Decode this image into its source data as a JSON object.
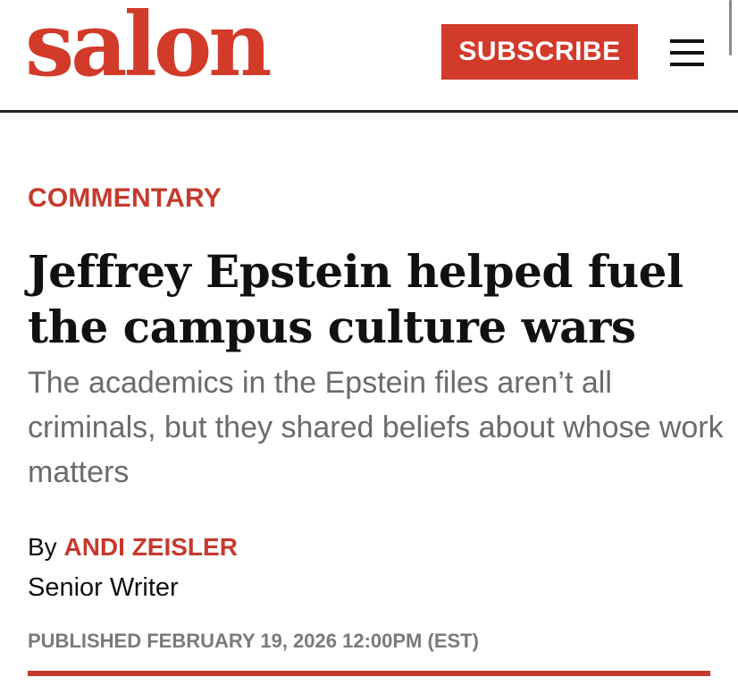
{
  "header": {
    "logo_text": "salon",
    "subscribe_label": "SUBSCRIBE",
    "menu_icon": "hamburger-menu-icon"
  },
  "article": {
    "kicker": "COMMENTARY",
    "headline": "Jeffrey Epstein helped fuel the campus culture wars",
    "dek": "The academics in the Epstein files aren’t all criminals, but they shared beliefs about whose work matters",
    "byline_prefix": "By",
    "author": "ANDI ZEISLER",
    "author_title": "Senior Writer",
    "published": "PUBLISHED FEBRUARY 19, 2026 12:00PM (EST)"
  },
  "colors": {
    "brand_red": "#d23a2a",
    "text": "#111111",
    "muted": "#6b6b6b"
  }
}
